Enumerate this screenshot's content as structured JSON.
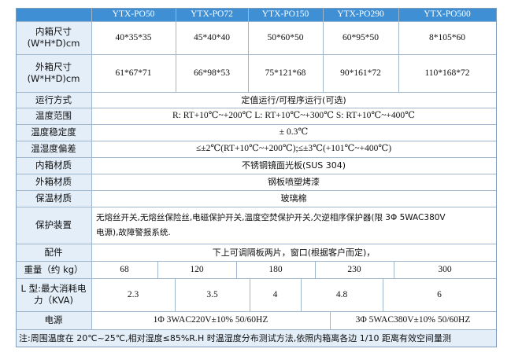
{
  "models": [
    "YTX-PO50",
    "YTX-PO72",
    "YTX-PO150",
    "YTX-PO290",
    "YTX-PO500"
  ],
  "inner_size": {
    "label_line1": "内箱尺寸",
    "label_line2": "(W*H*D)cm",
    "values": [
      "40*35*35",
      "45*40*40",
      "50*60*50",
      "60*95*50",
      "8*105*60"
    ]
  },
  "outer_size": {
    "label_line1": "外箱尺寸",
    "label_line2": "(W*H*D)cm",
    "values": [
      "61*67*71",
      "66*98*53",
      "75*121*68",
      "90*161*72",
      "110*168*72"
    ]
  },
  "rows": [
    {
      "label": "运行方式",
      "value": "定值运行/可程序运行(可选)"
    },
    {
      "label": "温度范围",
      "value": "R: RT+10℃~+200℃  L: RT+10℃~+300℃  S: RT+10℃~+400℃"
    },
    {
      "label": "温度稳定度",
      "value": "± 0.3℃"
    },
    {
      "label": "温湿度偏差",
      "value": "≤±2℃(RT+10℃~+200℃);≤±3℃(+101℃~+400℃)"
    },
    {
      "label": "内箱材质",
      "value": "不锈钢镜面光板(SUS 304)"
    },
    {
      "label": "外箱材质",
      "value": "钢板喷塑烤漆"
    },
    {
      "label": "保温材质",
      "value": "玻璃棉"
    }
  ],
  "protection": {
    "label": "保护装置",
    "line1": "无熔丝开关,无熔丝保险丝,电磁保护开关,温度空焚保护开关,欠逆相序保护器(限 3Φ 5WAC380V",
    "line2": "电源),故障警报系统."
  },
  "accessories": {
    "label": "配件",
    "value": "下上可调隔板两片，窗口(根据客户而定)，"
  },
  "weight": {
    "label": "重量（约 kg）",
    "values": [
      "68",
      "120",
      "180",
      "230",
      "300"
    ]
  },
  "power_consumption": {
    "label_line1": "L 型:最大消耗电",
    "label_line2": "力（KVA)",
    "values": [
      "2.3",
      "3.5",
      "4",
      "4.8",
      "6"
    ]
  },
  "power_supply": {
    "label": "电源",
    "value_a": "1Φ 3WAC220V±10% 50/60HZ",
    "value_b": "3Φ 5WAC380V±10% 50/60HZ"
  },
  "note": "注:周围温度在 20℃~25℃,相对湿度≤85%R.H 时温湿度分布测试方法,依照内箱离各边 1/10 距离有效空间量测"
}
